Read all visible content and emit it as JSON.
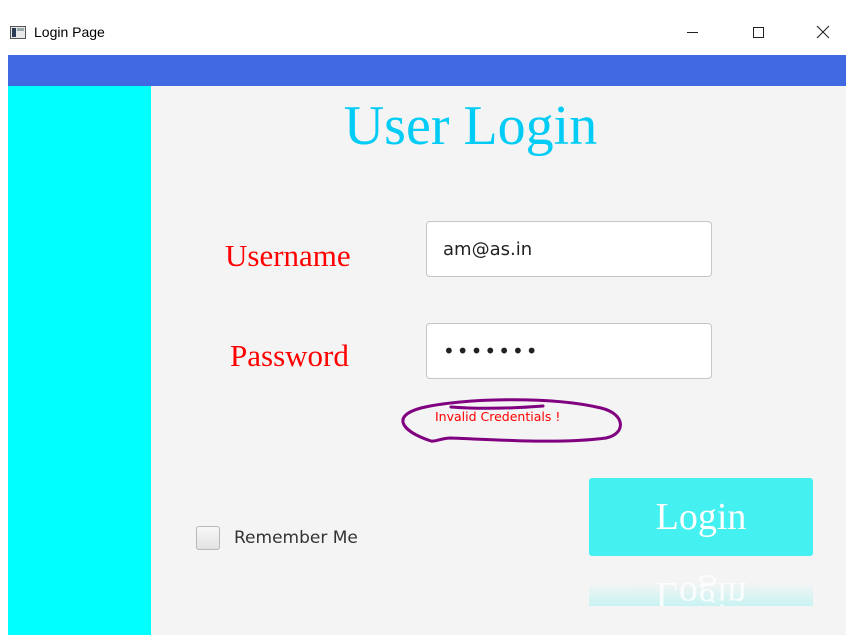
{
  "window": {
    "title": "Login Page"
  },
  "heading": "User Login",
  "form": {
    "username_label": "Username",
    "username_value": "am@as.in",
    "password_label": "Password",
    "password_value": "•••••••",
    "error_message": "Invalid Credentials !",
    "remember_label": "Remember Me",
    "remember_checked": false,
    "login_label": "Login"
  },
  "colors": {
    "topbar": "#4169e1",
    "sidebar": "#00ffff",
    "heading": "#00ccf5",
    "labels": "#ff0000",
    "login_button": "#44f0f0",
    "annotation": "#800080"
  }
}
